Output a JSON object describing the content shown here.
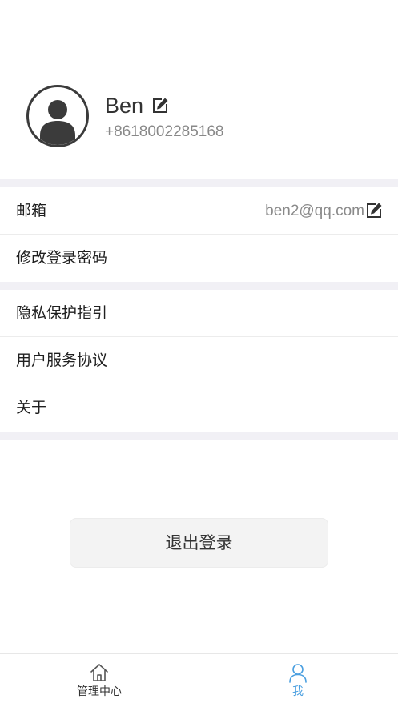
{
  "profile": {
    "name": "Ben",
    "phone": "+8618002285168"
  },
  "account_section": {
    "email_label": "邮箱",
    "email_value": "ben2@qq.com",
    "change_password_label": "修改登录密码"
  },
  "info_section": {
    "privacy_label": "隐私保护指引",
    "agreement_label": "用户服务协议",
    "about_label": "关于"
  },
  "logout": {
    "label": "退出登录"
  },
  "tabbar": {
    "home_label": "管理中心",
    "me_label": "我",
    "active": "me"
  },
  "colors": {
    "accent": "#4a9fe0",
    "separator": "#f1f0f5",
    "logout_bg": "#f3f3f3"
  },
  "icons": {
    "avatar": "user-avatar-icon",
    "edit": "edit-icon",
    "home": "home-icon",
    "me": "person-icon"
  }
}
